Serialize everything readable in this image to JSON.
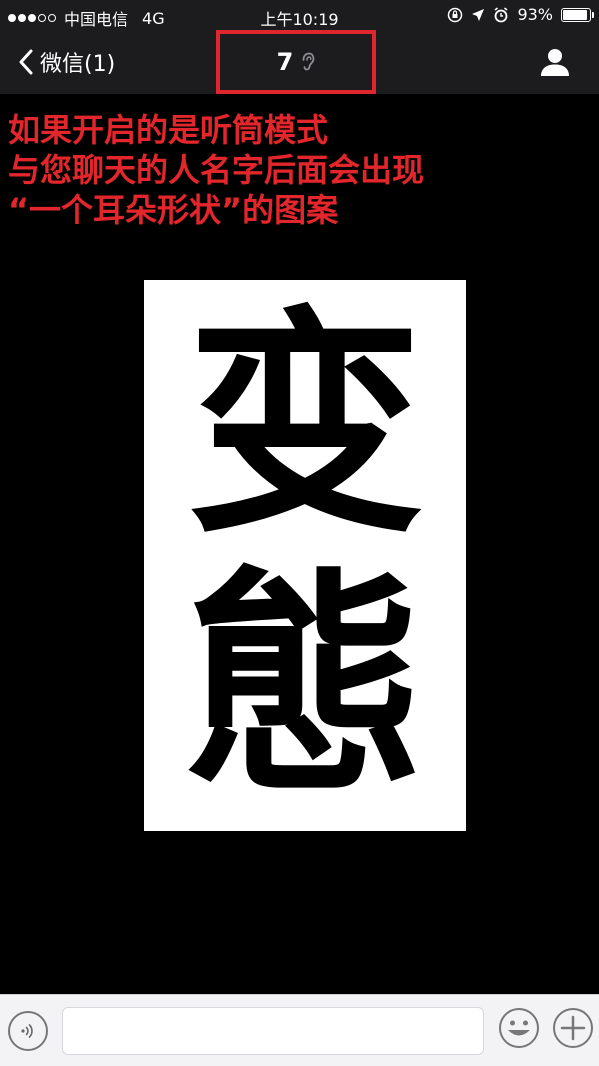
{
  "status_bar": {
    "carrier": "中国电信",
    "network": "4G",
    "time": "上午10:19",
    "battery_percent": "93%",
    "battery_level": 0.93,
    "icons": [
      "orientation-lock-icon",
      "location-arrow-icon",
      "alarm-icon",
      "battery-icon"
    ]
  },
  "nav": {
    "back_label": "微信(1)",
    "title": "7",
    "title_icon": "ear-icon",
    "right_icon": "contact-icon",
    "highlight_color": "#e0262d"
  },
  "annotation": {
    "lines": [
      "如果开启的是听筒模式",
      "与您聊天的人名字后面会出现",
      "“一个耳朵形状”的图案"
    ],
    "color": "#e3262c"
  },
  "message_image": {
    "characters": [
      "变",
      "態"
    ]
  },
  "input_bar": {
    "voice_icon": "voice-icon",
    "text_value": "",
    "emoji_icon": "emoji-icon",
    "plus_icon": "plus-icon"
  }
}
